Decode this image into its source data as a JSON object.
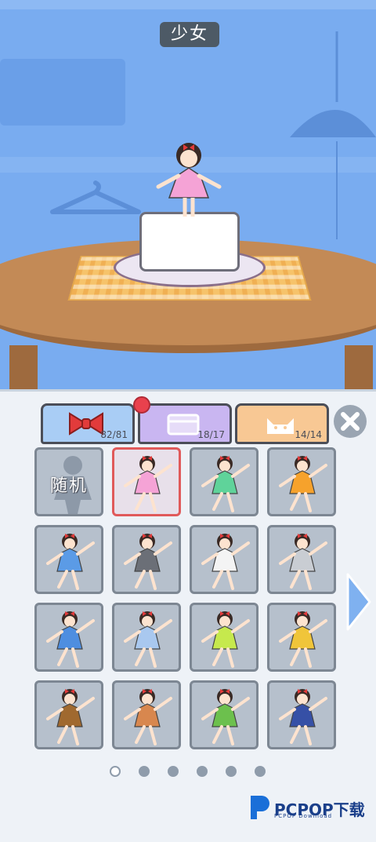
{
  "scene": {
    "character_name": "少女"
  },
  "tabs": [
    {
      "icon": "bow-icon",
      "count": "82/81",
      "color": "#a9cdf5"
    },
    {
      "icon": "box-icon",
      "count": "18/17",
      "color": "#c9b6f1"
    },
    {
      "icon": "cat-icon",
      "count": "14/14",
      "color": "#f8c894"
    }
  ],
  "grid": {
    "random_label": "随机",
    "selected_index": 1,
    "outfits": [
      {
        "icon": "random-silhouette-icon",
        "dress": "#ffffff"
      },
      {
        "icon": "pink-dress-icon",
        "dress": "#f5a3d6"
      },
      {
        "icon": "green-dress-icon",
        "dress": "#5fd39a"
      },
      {
        "icon": "orange-dress-icon",
        "dress": "#f6a22c"
      },
      {
        "icon": "blue-dress-icon",
        "dress": "#5b9be6"
      },
      {
        "icon": "gray-dress-glasses-icon",
        "dress": "#6b6f77"
      },
      {
        "icon": "white-dress-hat-icon",
        "dress": "#f4f4f4"
      },
      {
        "icon": "plaid-dress-icon",
        "dress": "#c9cdd3"
      },
      {
        "icon": "dotted-blue-dress-icon",
        "dress": "#4e8ee0"
      },
      {
        "icon": "striped-dress-icon",
        "dress": "#a9c8ef"
      },
      {
        "icon": "yellow-green-dress-icon",
        "dress": "#c6e94d"
      },
      {
        "icon": "yellow-top-jeans-icon",
        "dress": "#f0c53a"
      },
      {
        "icon": "brown-sweater-icon",
        "dress": "#a0692f"
      },
      {
        "icon": "brown-apron-kettle-icon",
        "dress": "#d8874e"
      },
      {
        "icon": "green-apron-pan-icon",
        "dress": "#6cc04d"
      },
      {
        "icon": "chef-paddle-icon",
        "dress": "#3650a6"
      }
    ]
  },
  "pagination": {
    "pages": 6,
    "active": 0
  },
  "watermark": {
    "text": "PCPOP下载",
    "sub": "PCPOP Download"
  }
}
